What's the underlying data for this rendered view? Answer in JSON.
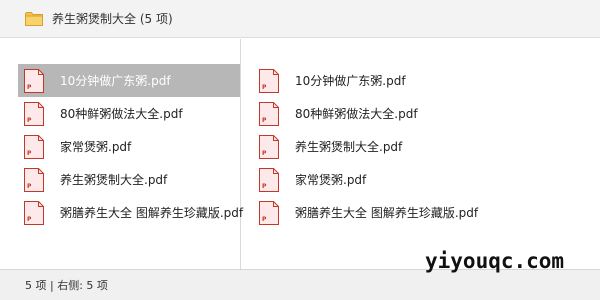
{
  "window": {
    "title": "养生粥煲制大全 (5 项)",
    "icon": "folder-icon"
  },
  "left_pane": {
    "files": [
      {
        "name": "10分钟做广东粥.pdf",
        "icon": "pdf-icon",
        "selected": true
      },
      {
        "name": "80种鲜粥做法大全.pdf",
        "icon": "pdf-icon",
        "selected": false
      },
      {
        "name": "家常煲粥.pdf",
        "icon": "pdf-icon",
        "selected": false
      },
      {
        "name": "养生粥煲制大全.pdf",
        "icon": "pdf-icon",
        "selected": false
      },
      {
        "name": "粥膳养生大全  图解养生珍藏版.pdf",
        "icon": "pdf-icon",
        "selected": false
      }
    ]
  },
  "right_pane": {
    "files": [
      {
        "name": "10分钟做广东粥.pdf",
        "icon": "pdf-icon"
      },
      {
        "name": "80种鲜粥做法大全.pdf",
        "icon": "pdf-icon"
      },
      {
        "name": "养生粥煲制大全.pdf",
        "icon": "pdf-icon"
      },
      {
        "name": "家常煲粥.pdf",
        "icon": "pdf-icon"
      },
      {
        "name": "粥膳养生大全  图解养生珍藏版.pdf",
        "icon": "pdf-icon"
      }
    ]
  },
  "status": {
    "text": "5 项 | 右侧: 5 项"
  },
  "watermark": {
    "text": "yiyouqc.com"
  },
  "colors": {
    "selection": "#b7b7b7",
    "folder": "#f5c34a",
    "pdf_border": "#c0392b",
    "pdf_fill": "#fde9ea"
  }
}
